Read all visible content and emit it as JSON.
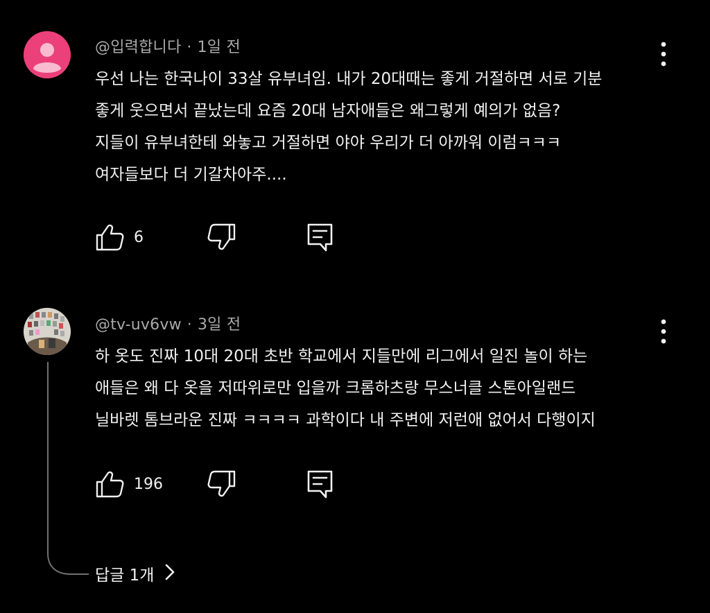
{
  "comments": [
    {
      "author": "@입력합니다",
      "separator": "·",
      "time": "1일 전",
      "lines": [
        "우선 나는 한국나이 33살 유부녀임. 내가 20대때는 좋게 거절하면 서로 기분",
        "좋게 웃으면서 끝났는데 요즘 20대 남자애들은 왜그렇게 예의가 없음?",
        "지들이 유부녀한테 와놓고 거절하면 야야 우리가 더 아까워 이럼ㅋㅋㅋ",
        "여자들보다 더 기갈차아주...."
      ],
      "likes": "6",
      "avatar_color": "#ec407a"
    },
    {
      "author": "@tv-uv6vw",
      "separator": "·",
      "time": "3일 전",
      "lines": [
        "하 옷도 진짜 10대 20대 초반 학교에서 지들만에 리그에서 일진 놀이 하는",
        "애들은 왜 다 옷을 저따위로만 입을까  크롬하츠랑 무스너클 스톤아일랜드",
        "닐바렛 톰브라운  진짜 ㅋㅋㅋㅋ 과학이다 내 주변에 저런애 없어서 다행이지"
      ],
      "likes": "196",
      "replies_label": "답글 1개"
    }
  ],
  "icons": {
    "more": "more-vert-icon",
    "like": "thumb-up-icon",
    "dislike": "thumb-down-icon",
    "reply": "comment-reply-icon",
    "chevron": "chevron-right-icon"
  }
}
